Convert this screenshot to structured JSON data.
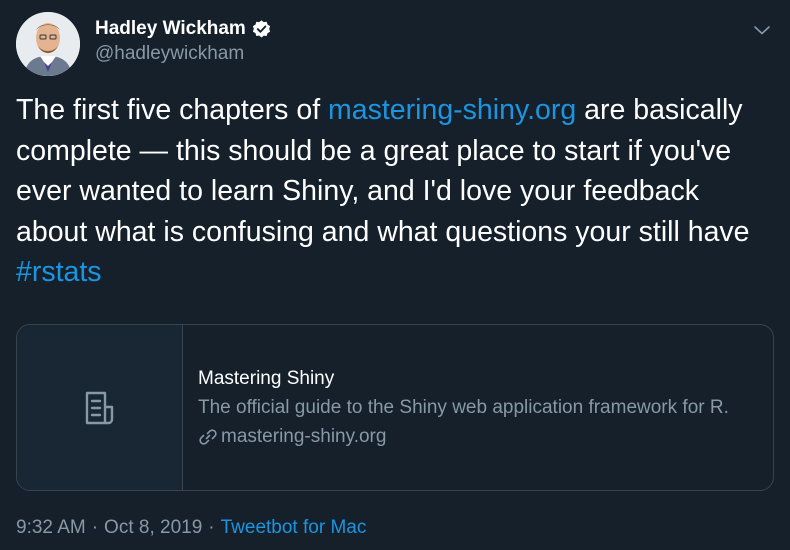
{
  "author": {
    "display_name": "Hadley Wickham",
    "handle": "@hadleywickham",
    "verified": true
  },
  "tweet": {
    "text_1": "The first five chapters of ",
    "link_text": "mastering-shiny.org",
    "text_2": " are basically complete — this should be a great place to start if you've ever wanted to learn Shiny, and I'd love your feedback about what is confusing and what questions your still have ",
    "hashtag": "#rstats"
  },
  "card": {
    "title": "Mastering Shiny",
    "description": "The official guide to the Shiny web application framework for R.",
    "domain": "mastering-shiny.org"
  },
  "meta": {
    "time": "9:32 AM",
    "separator_1": "·",
    "date": "Oct 8, 2019",
    "separator_2": "·",
    "source": "Tweetbot for Mac"
  },
  "icons": {
    "verified": "verified-badge-icon",
    "caret": "chevron-down-icon",
    "card_thumbnail": "document-icon",
    "link": "link-icon"
  },
  "colors": {
    "background": "#15202b",
    "accent": "#1b95e0",
    "secondary_text": "#8899a6",
    "border": "#38444d"
  }
}
